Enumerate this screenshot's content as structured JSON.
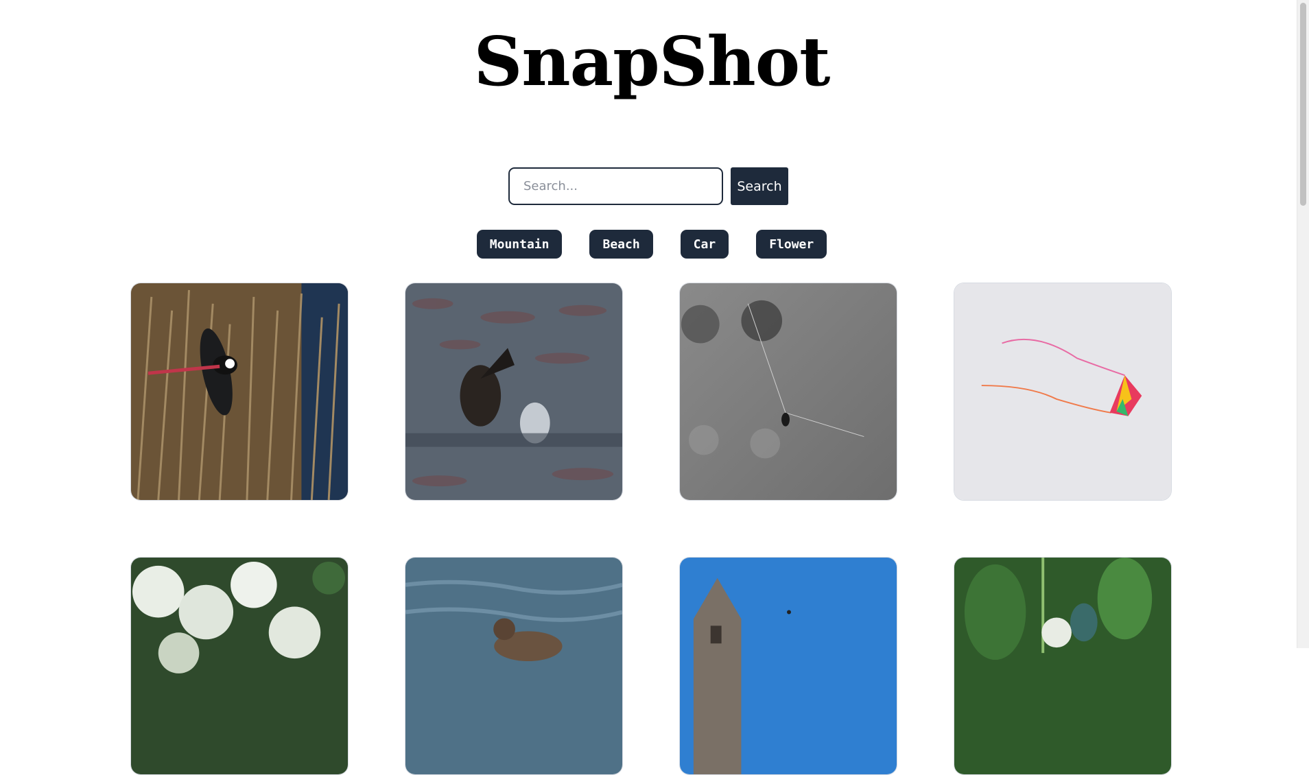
{
  "header": {
    "title": "SnapShot"
  },
  "search": {
    "placeholder": "Search...",
    "value": "",
    "button_label": "Search"
  },
  "categories": [
    "Mountain",
    "Beach",
    "Car",
    "Flower"
  ],
  "gallery": {
    "photos": [
      {
        "subject": "stilt bird flying over dry reeds"
      },
      {
        "subject": "cormorant splashing in water"
      },
      {
        "subject": "spider on web, grey background"
      },
      {
        "subject": "rainbow kite in pale sky"
      },
      {
        "subject": "white hydrangea flowers"
      },
      {
        "subject": "duck swimming on blue water"
      },
      {
        "subject": "stone church tower with blue sky"
      },
      {
        "subject": "fly on green leaves"
      }
    ]
  },
  "colors": {
    "accent": "#1e2a3b",
    "background": "#ffffff"
  }
}
